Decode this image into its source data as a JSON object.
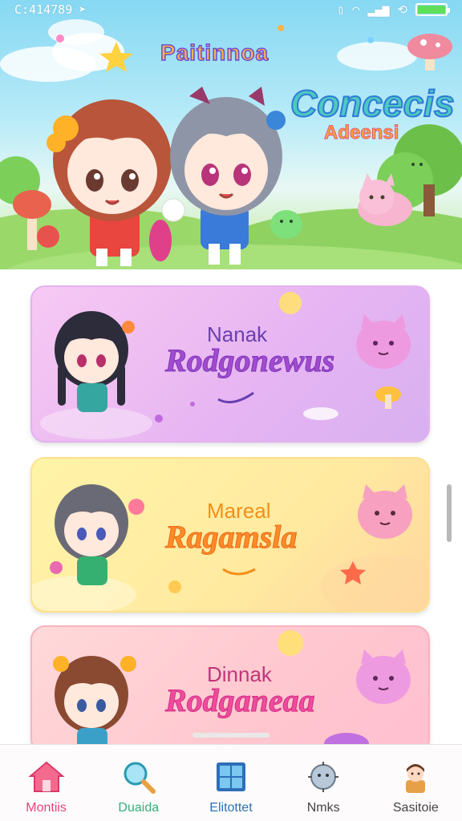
{
  "status_bar": {
    "time": "C:414789",
    "battery_level": 1.0
  },
  "hero": {
    "title": "Paitinnoa",
    "subtitle_line1": "Concecis",
    "subtitle_line2": "Adeensi"
  },
  "cards": [
    {
      "title": "Nanak",
      "name": "Rodgonewus",
      "theme": "#e6b4f2"
    },
    {
      "title": "Mareal",
      "name": "Ragamsla",
      "theme": "#ffeaa0"
    },
    {
      "title": "Dinnak",
      "name": "Rodganeaa",
      "theme": "#ffc7cf"
    }
  ],
  "bottom_nav": [
    {
      "label": "Montiis",
      "icon": "home-icon"
    },
    {
      "label": "Duaida",
      "icon": "search-icon"
    },
    {
      "label": "Elitottet",
      "icon": "grid-icon"
    },
    {
      "label": "Nmks",
      "icon": "orb-icon"
    },
    {
      "label": "Sasitoie",
      "icon": "profile-avatar-icon"
    }
  ],
  "colors": {
    "accent_pink": "#e8447a",
    "accent_green": "#34b07e",
    "accent_blue": "#2d6fb8"
  }
}
